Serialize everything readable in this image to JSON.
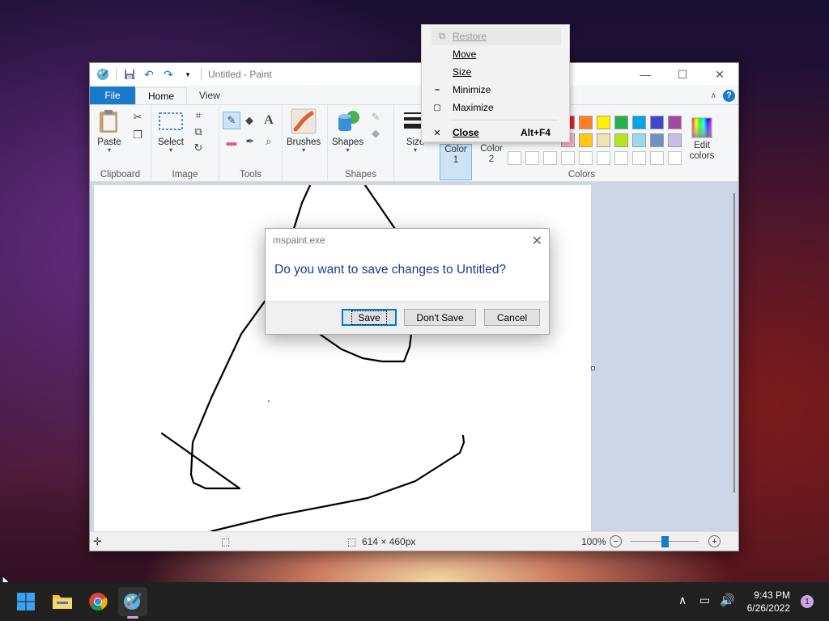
{
  "window": {
    "title": "Untitled - Paint",
    "tabs": {
      "file": "File",
      "home": "Home",
      "view": "View"
    }
  },
  "ribbon": {
    "clipboard": {
      "paste": "Paste",
      "label": "Clipboard"
    },
    "image": {
      "select": "Select",
      "label": "Image"
    },
    "tools": {
      "label": "Tools"
    },
    "brushes": "Brushes",
    "shapes": {
      "button": "Shapes",
      "label": "Shapes"
    },
    "size": "Size",
    "color1": {
      "line1": "Color",
      "line2": "1"
    },
    "color2": {
      "line1": "Color",
      "line2": "2"
    },
    "colors_label": "Colors",
    "edit_colors": {
      "line1": "Edit",
      "line2": "colors"
    },
    "palette_row1": [
      "#ed1c24",
      "#ff7f27",
      "#fff200",
      "#22b14c",
      "#00a2e8",
      "#3f48cc",
      "#a349a4"
    ],
    "palette_row2": [
      "#ffaec9",
      "#ffc90e",
      "#efe4b0",
      "#b5e61d",
      "#99d9ea",
      "#7092be",
      "#c8bfe7"
    ]
  },
  "context_menu": {
    "restore": "Restore",
    "move": "Move",
    "size": "Size",
    "minimize": "Minimize",
    "maximize": "Maximize",
    "close": "Close",
    "close_accel": "Alt+F4"
  },
  "dialog": {
    "title": "mspaint.exe",
    "message": "Do you want to save changes to Untitled?",
    "save": "Save",
    "dont_save": "Don't Save",
    "cancel": "Cancel"
  },
  "statusbar": {
    "dimensions": "614 × 460px",
    "zoom": "100%"
  },
  "taskbar": {
    "time": "9:43 PM",
    "date": "6/26/2022",
    "notification_count": "1"
  }
}
